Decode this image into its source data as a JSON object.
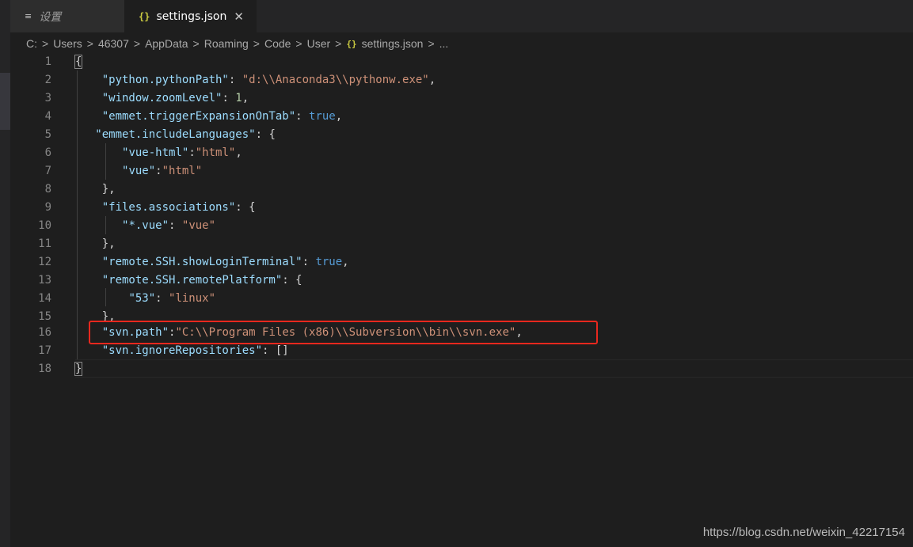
{
  "tabs": {
    "settings_ui": {
      "icon": "≡",
      "label": "设置"
    },
    "settings_json": {
      "icon": "{}",
      "label": "settings.json",
      "close": "✕"
    }
  },
  "breadcrumb": {
    "items": [
      "C:",
      "Users",
      "46307",
      "AppData",
      "Roaming",
      "Code",
      "User"
    ],
    "file_icon": "{}",
    "file": "settings.json",
    "trailing": "...",
    "separator": ">"
  },
  "editor": {
    "line_numbers": [
      "1",
      "2",
      "3",
      "4",
      "5",
      "6",
      "7",
      "8",
      "9",
      "10",
      "11",
      "12",
      "13",
      "14",
      "15",
      "16",
      "17",
      "18"
    ],
    "lines": {
      "l1": {
        "open": "{"
      },
      "l2": {
        "key": "\"python.pythonPath\"",
        "sep": ": ",
        "val": "\"d:\\\\Anaconda3\\\\pythonw.exe\"",
        "end": ","
      },
      "l3": {
        "key": "\"window.zoomLevel\"",
        "sep": ": ",
        "val": "1",
        "end": ","
      },
      "l4": {
        "key": "\"emmet.triggerExpansionOnTab\"",
        "sep": ": ",
        "val": "true",
        "end": ","
      },
      "l5": {
        "key": "\"emmet.includeLanguages\"",
        "sep": ": {"
      },
      "l6": {
        "key": "\"vue-html\"",
        "sep": ":",
        "val": "\"html\"",
        "end": ","
      },
      "l7": {
        "key": "\"vue\"",
        "sep": ":",
        "val": "\"html\""
      },
      "l8": {
        "text": "},"
      },
      "l9": {
        "key": "\"files.associations\"",
        "sep": ": {"
      },
      "l10": {
        "key": "\"*.vue\"",
        "sep": ": ",
        "val": "\"vue\""
      },
      "l11": {
        "text": "},"
      },
      "l12": {
        "key": "\"remote.SSH.showLoginTerminal\"",
        "sep": ": ",
        "val": "true",
        "end": ","
      },
      "l13": {
        "key": "\"remote.SSH.remotePlatform\"",
        "sep": ": {"
      },
      "l14": {
        "key": "\"53\"",
        "sep": ": ",
        "val": "\"linux\""
      },
      "l15": {
        "text": "},"
      },
      "l16": {
        "key": "\"svn.path\"",
        "sep": ":",
        "val": "\"C:\\\\Program Files (x86)\\\\Subversion\\\\bin\\\\svn.exe\"",
        "end": ","
      },
      "l17": {
        "key": "\"svn.ignoreRepositories\"",
        "sep": ": ",
        "val": "[]"
      },
      "l18": {
        "close": "}"
      }
    }
  },
  "watermark": "https://blog.csdn.net/weixin_42217154",
  "colors": {
    "background": "#1e1e1e",
    "key": "#9cdcfe",
    "string": "#ce9178",
    "number": "#b5cea8",
    "boolean": "#569cd6",
    "highlight_box": "#e8281e"
  }
}
